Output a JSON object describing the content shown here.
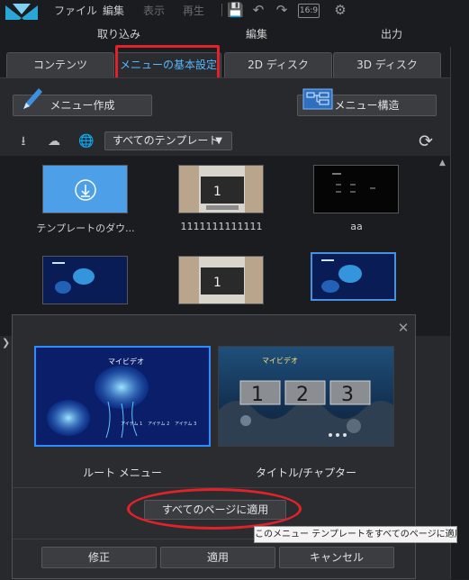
{
  "menubar": {
    "items": [
      "ファイル",
      "編集",
      "表示",
      "再生"
    ],
    "aspect": "16:9"
  },
  "modules": [
    "取り込み",
    "編集",
    "出力"
  ],
  "tabs": [
    "コンテンツ",
    "メニューの基本設定",
    "2D ディスク",
    "3D ディスク"
  ],
  "toolbar": {
    "menu_create": "メニュー作成",
    "menu_structure": "メニュー構造",
    "template_filter": "すべてのテンプレート"
  },
  "templates": [
    {
      "label": "テンプレートのダウ..."
    },
    {
      "label": "1111111111111"
    },
    {
      "label": "aa"
    },
    {
      "label": ""
    },
    {
      "label": ""
    },
    {
      "label": ""
    }
  ],
  "dialog": {
    "root_menu_label": "ルート メニュー",
    "title_chapter_label": "タイトル/チャプター",
    "apply_all": "すべてのページに適用",
    "tooltip": "このメニュー テンプレートをすべてのページに適用",
    "modify": "修正",
    "apply": "適用",
    "cancel": "キャンセル",
    "preview_text": {
      "title": "マイビデオ",
      "items": [
        "アイテム 1",
        "アイテム 2",
        "アイテム 3"
      ],
      "chapter_numbers": [
        "1",
        "2",
        "3"
      ]
    }
  },
  "colors": {
    "accent": "#2f8cff",
    "highlight_red": "#e0222a",
    "active_tab_text": "#57b8ff"
  }
}
